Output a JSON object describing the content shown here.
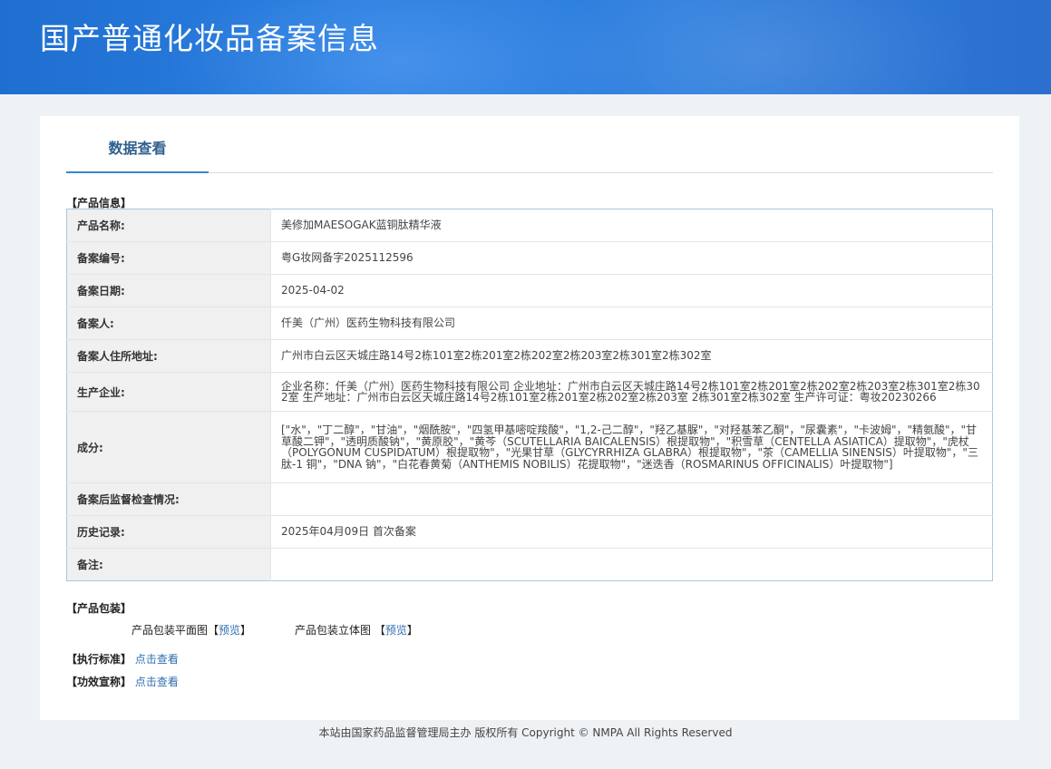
{
  "banner": {
    "title": "国产普通化妆品备案信息"
  },
  "tabs": {
    "active_label": "数据查看"
  },
  "product_info": {
    "section_label": "【产品信息】",
    "rows": [
      {
        "key": "产品名称:",
        "value": "美修加MAESOGAK蓝铜肽精华液"
      },
      {
        "key": "备案编号:",
        "value": "粤G妆网备字2025112596"
      },
      {
        "key": "备案日期:",
        "value": "2025-04-02"
      },
      {
        "key": "备案人:",
        "value": "仟美（广州）医药生物科技有限公司"
      },
      {
        "key": "备案人住所地址:",
        "value": "广州市白云区天城庄路14号2栋101室2栋201室2栋202室2栋203室2栋301室2栋302室"
      },
      {
        "key": "生产企业:",
        "value": "企业名称：仟美（广州）医药生物科技有限公司 企业地址：广州市白云区天城庄路14号2栋101室2栋201室2栋202室2栋203室2栋301室2栋302室 生产地址：广州市白云区天城庄路14号2栋101室2栋201室2栋202室2栋203室 2栋301室2栋302室 生产许可证：粤妆20230266"
      },
      {
        "key": "成分:",
        "value": "[\"水\"，\"丁二醇\"，\"甘油\"，\"烟酰胺\"，\"四氢甲基嘧啶羧酸\"，\"1,2-己二醇\"，\"羟乙基脲\"，\"对羟基苯乙酮\"，\"尿囊素\"，\"卡波姆\"，\"精氨酸\"，\"甘草酸二钾\"，\"透明质酸钠\"，\"黄原胶\"，\"黄芩（SCUTELLARIA BAICALENSIS）根提取物\"，\"积雪草（CENTELLA ASIATICA）提取物\"，\"虎杖（POLYGONUM CUSPIDATUM）根提取物\"，\"光果甘草（GLYCYRRHIZA GLABRA）根提取物\"，\"茶（CAMELLIA SINENSIS）叶提取物\"，\"三肽-1 铜\"，\"DNA 钠\"，\"白花春黄菊（ANTHEMIS NOBILIS）花提取物\"，\"迷迭香（ROSMARINUS OFFICINALIS）叶提取物\"]"
      },
      {
        "key": "备案后监督检查情况:",
        "value": ""
      },
      {
        "key": "历史记录:",
        "value": "2025年04月09日 首次备案"
      },
      {
        "key": "备注:",
        "value": ""
      }
    ]
  },
  "packaging": {
    "section_label": "【产品包装】",
    "flat_label": "产品包装平面图",
    "flat_link": "预览",
    "stereo_label": "产品包装立体图",
    "stereo_link": "预览"
  },
  "standard": {
    "label": "【执行标准】",
    "link": "点击查看"
  },
  "efficacy": {
    "label": "【功效宣称】",
    "link": "点击查看"
  },
  "footer": {
    "text": "本站由国家药品监督管理局主办 版权所有 Copyright © NMPA All Rights Reserved"
  }
}
